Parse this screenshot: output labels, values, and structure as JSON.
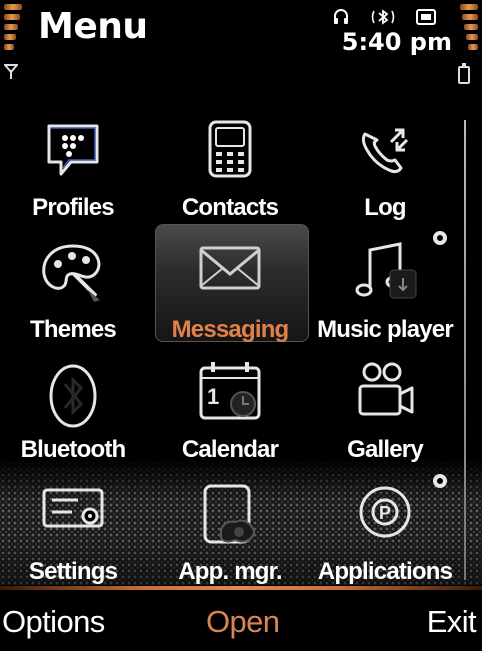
{
  "header": {
    "title": "Menu",
    "time": "5:40 pm",
    "status_icons": [
      "headset-icon",
      "bluetooth-icon",
      "message-icon"
    ]
  },
  "grid": [
    {
      "label": "Profiles",
      "icon": "bbm-chat-icon"
    },
    {
      "label": "Contacts",
      "icon": "contacts-phone-icon"
    },
    {
      "label": "Log",
      "icon": "call-log-icon"
    },
    {
      "label": "Themes",
      "icon": "palette-icon"
    },
    {
      "label": "Messaging",
      "icon": "envelope-icon",
      "selected": true
    },
    {
      "label": "Music player",
      "icon": "music-note-icon"
    },
    {
      "label": "Bluetooth",
      "icon": "bluetooth-icon"
    },
    {
      "label": "Calendar",
      "icon": "calendar-icon"
    },
    {
      "label": "Gallery",
      "icon": "camera-icon"
    },
    {
      "label": "Settings",
      "icon": "settings-icon"
    },
    {
      "label": "App. mgr.",
      "icon": "app-manager-icon"
    },
    {
      "label": "Applications",
      "icon": "applications-icon"
    }
  ],
  "softkeys": {
    "left": "Options",
    "center": "Open",
    "right": "Exit"
  },
  "colors": {
    "accent": "#e0814a",
    "background": "#000000",
    "text": "#ffffff"
  }
}
